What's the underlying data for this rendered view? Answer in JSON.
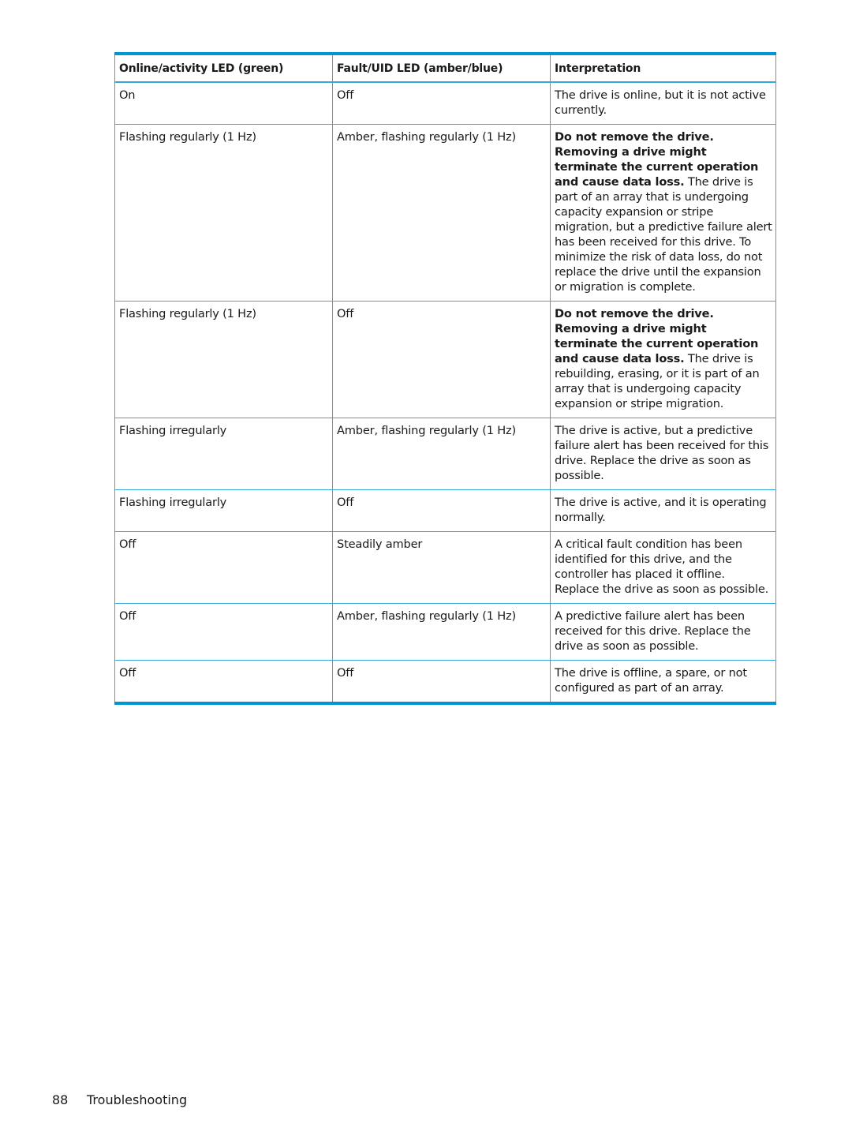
{
  "table": {
    "headers": [
      "Online/activity LED (green)",
      "Fault/UID LED (amber/blue)",
      "Interpretation"
    ],
    "rows": [
      {
        "online": "On",
        "fault": "Off",
        "warning": "",
        "interpretation": "The drive is online, but it is not active currently."
      },
      {
        "online": "Flashing regularly (1 Hz)",
        "fault": "Amber, flashing regularly (1 Hz)",
        "warning": "Do not remove the drive. Removing a drive might terminate the current operation and cause data loss.",
        "interpretation": " The drive is part of an array that is undergoing capacity expansion or stripe migration, but a predictive failure alert has been received for this drive. To minimize the risk of data loss, do not replace the drive until the expansion or migration is complete."
      },
      {
        "online": "Flashing regularly (1 Hz)",
        "fault": "Off",
        "warning": "Do not remove the drive. Removing a drive might terminate the current operation and cause data loss.",
        "interpretation": " The drive is rebuilding, erasing, or it is part of an array that is undergoing capacity expansion or stripe migration."
      },
      {
        "online": "Flashing irregularly",
        "fault": "Amber, flashing regularly (1 Hz)",
        "warning": "",
        "interpretation": "The drive is active, but a predictive failure alert has been received for this drive. Replace the drive as soon as possible."
      },
      {
        "online": "Flashing irregularly",
        "fault": "Off",
        "warning": "",
        "interpretation": "The drive is active, and it is operating normally."
      },
      {
        "online": "Off",
        "fault": "Steadily amber",
        "warning": "",
        "interpretation": "A critical fault condition has been identified for this drive, and the controller has placed it offline. Replace the drive as soon as possible."
      },
      {
        "online": "Off",
        "fault": "Amber, flashing regularly (1 Hz)",
        "warning": "",
        "interpretation": "A predictive failure alert has been received for this drive. Replace the drive as soon as possible."
      },
      {
        "online": "Off",
        "fault": "Off",
        "warning": "",
        "interpretation": "The drive is offline, a spare, or not configured as part of an array."
      }
    ]
  },
  "footer": {
    "page_number": "88",
    "section": "Troubleshooting"
  },
  "colors": {
    "table_rule": "#0096d6",
    "cell_border": "#3aa7dc"
  }
}
